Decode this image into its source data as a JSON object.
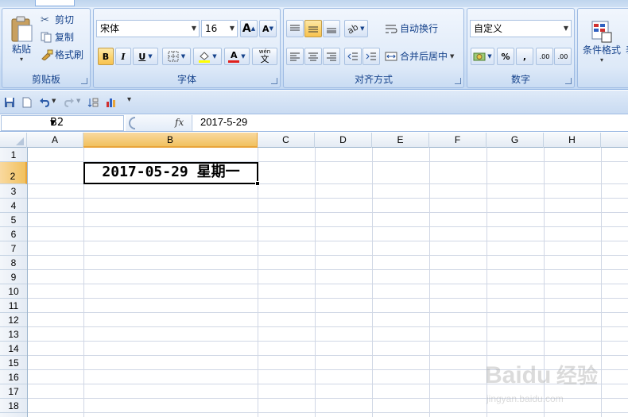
{
  "ribbon": {
    "clipboard": {
      "group_label": "剪贴板",
      "paste": "粘贴",
      "cut": "剪切",
      "copy": "复制",
      "format_painter": "格式刷"
    },
    "font": {
      "group_label": "字体",
      "font_name": "宋体",
      "font_size": "16",
      "grow_label": "A",
      "shrink_label": "A",
      "bold": "B",
      "italic": "I",
      "underline": "U",
      "font_color_label": "A",
      "phonetic_label": "wén"
    },
    "alignment": {
      "group_label": "对齐方式",
      "wrap_text": "自动换行",
      "merge_center": "合并后居中"
    },
    "number": {
      "group_label": "数字",
      "format": "自定义",
      "percent": "%",
      "comma": ",",
      "inc_decimal": ".00",
      "dec_decimal": ".00"
    },
    "styles": {
      "conditional_format": "条件格式",
      "partial_label": "表"
    }
  },
  "formula_bar": {
    "name_box": "B2",
    "fx_label": "fx",
    "formula": "2017-5-29"
  },
  "sheet": {
    "columns": [
      "A",
      "B",
      "C",
      "D",
      "E",
      "F",
      "G",
      "H"
    ],
    "rows": [
      "1",
      "2",
      "3",
      "4",
      "5",
      "6",
      "7",
      "8",
      "9",
      "10",
      "11",
      "12",
      "13",
      "14",
      "15",
      "16",
      "17",
      "18"
    ],
    "selected_cell": "B2",
    "cell_b2": "2017-05-29 星期一"
  },
  "watermark": {
    "brand": "Baidu",
    "sub": "经验",
    "url": "jingyan.baidu.com"
  },
  "colors": {
    "accent": "#f1c15f",
    "ribbon": "#dbe8f8",
    "grid": "#d0d7e5",
    "font_color": "#e0201c",
    "fill_color": "#ffff00"
  }
}
